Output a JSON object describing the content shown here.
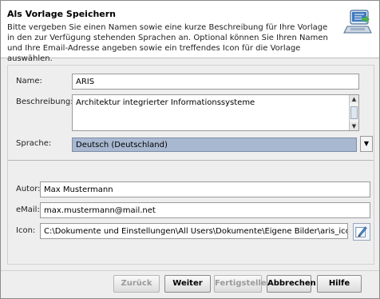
{
  "header": {
    "title": "Als Vorlage Speichern",
    "description": "Bitte vergeben Sie einen Namen sowie eine kurze Beschreibung für Ihre Vorlage in den zur Verfügung stehenden Sprachen an. Optional können Sie Ihren Namen und Ihre Email-Adresse angeben sowie ein treffendes Icon für die Vorlage auswählen."
  },
  "form": {
    "name_label": "Name:",
    "name_value": "ARIS",
    "description_label": "Beschreibung:",
    "description_value": "Architektur integrierter Informationssysteme",
    "language_label": "Sprache:",
    "language_value": "Deutsch (Deutschland)",
    "author_label": "Autor:",
    "author_value": "Max Mustermann",
    "email_label": "eMail:",
    "email_value": "max.mustermann@mail.net",
    "icon_label": "Icon:",
    "icon_value": "C:\\Dokumente und Einstellungen\\All Users\\Dokumente\\Eigene Bilder\\aris_icon.jpg"
  },
  "buttons": {
    "back": "Zurück",
    "next": "Weiter",
    "finish": "Fertigstellen",
    "cancel": "Abbrechen",
    "help": "Hilfe"
  }
}
